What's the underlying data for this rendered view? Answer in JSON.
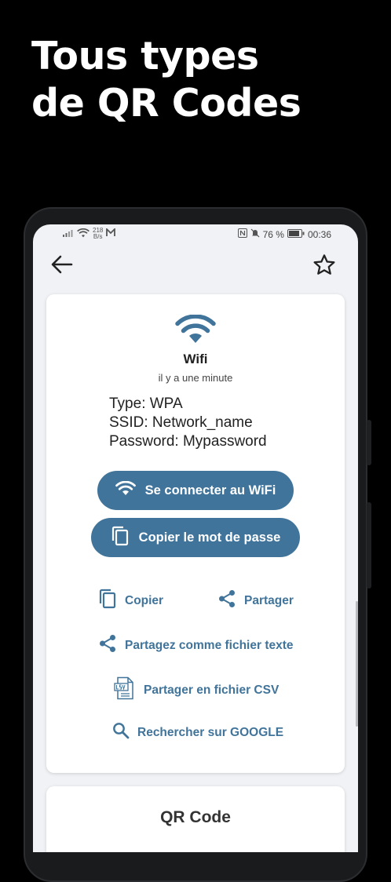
{
  "promo": {
    "line1": "Tous types",
    "line2": "de QR Codes"
  },
  "statusbar": {
    "net_speed_value": "218",
    "net_speed_unit": "B/s",
    "battery": "76 %",
    "time": "00:36"
  },
  "appbar": {
    "back_icon": "arrow-left-icon",
    "favorite_icon": "star-outline-icon"
  },
  "result": {
    "type_icon": "wifi-icon",
    "title": "Wifi",
    "time": "il y a une minute",
    "details": [
      "Type: WPA",
      "SSID: Network_name",
      "Password: Mypassword"
    ]
  },
  "buttons": {
    "connect": "Se connecter au WiFi",
    "copy_password": "Copier le mot de passe"
  },
  "actions": {
    "copy": "Copier",
    "share": "Partager",
    "share_text_file": "Partagez comme fichier texte",
    "share_csv": "Partager en fichier CSV",
    "search_google": "Rechercher sur GOOGLE"
  },
  "qr_section": {
    "title": "QR Code"
  },
  "colors": {
    "accent": "#41749a",
    "background": "#f0f2f5",
    "card": "#ffffff"
  }
}
